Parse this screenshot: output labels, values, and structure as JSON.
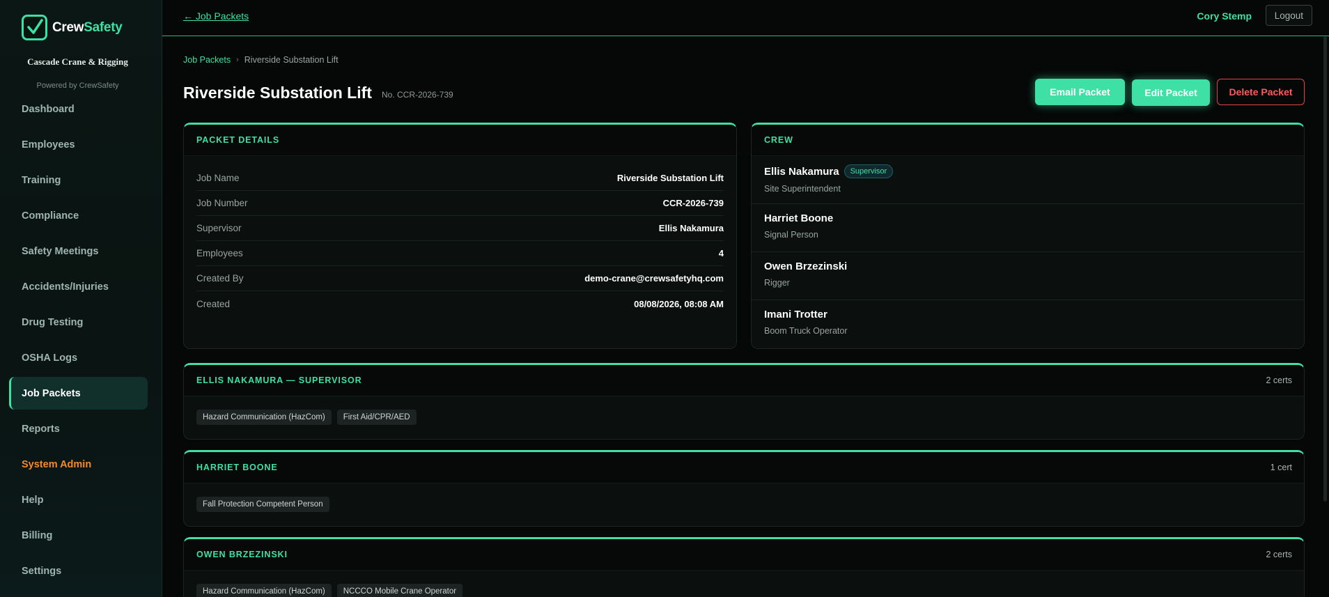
{
  "brand": {
    "word1": "Crew",
    "word2": "Safety"
  },
  "sidebar": {
    "company": "Cascade Crane & Rigging",
    "powered_by": "Powered by CrewSafety",
    "items": [
      {
        "label": "Dashboard"
      },
      {
        "label": "Employees"
      },
      {
        "label": "Training"
      },
      {
        "label": "Compliance"
      },
      {
        "label": "Safety Meetings"
      },
      {
        "label": "Accidents/Injuries"
      },
      {
        "label": "Drug Testing"
      },
      {
        "label": "OSHA Logs"
      },
      {
        "label": "Job Packets"
      },
      {
        "label": "Reports"
      },
      {
        "label": "System Admin"
      },
      {
        "label": "Help"
      },
      {
        "label": "Billing"
      },
      {
        "label": "Settings"
      }
    ]
  },
  "topbar": {
    "back_link": "← Job Packets",
    "user_name": "Cory Stemp",
    "logout": "Logout"
  },
  "breadcrumb": {
    "parent": "Job Packets",
    "separator": "›",
    "current": "Riverside Substation Lift"
  },
  "page": {
    "title": "Riverside Substation Lift",
    "job_number": "No. CCR-2026-739",
    "actions": {
      "email": "Email Packet",
      "edit": "Edit Packet",
      "delete": "Delete Packet"
    }
  },
  "packet_details": {
    "header": "PACKET DETAILS",
    "rows": [
      {
        "label": "Job Name",
        "value": "Riverside Substation Lift"
      },
      {
        "label": "Job Number",
        "value": "CCR-2026-739"
      },
      {
        "label": "Supervisor",
        "value": "Ellis Nakamura"
      },
      {
        "label": "Employees",
        "value": "4"
      },
      {
        "label": "Created By",
        "value": "demo-crane@crewsafetyhq.com"
      },
      {
        "label": "Created",
        "value": "08/08/2026, 08:08 AM"
      }
    ]
  },
  "crew": {
    "header": "CREW",
    "members": [
      {
        "name": "Ellis Nakamura",
        "badge": "Supervisor",
        "role": "Site Superintendent"
      },
      {
        "name": "Harriet Boone",
        "role": "Signal Person"
      },
      {
        "name": "Owen Brzezinski",
        "role": "Rigger"
      },
      {
        "name": "Imani Trotter",
        "role": "Boom Truck Operator"
      }
    ]
  },
  "cert_sections": [
    {
      "title": "ELLIS NAKAMURA — SUPERVISOR",
      "count": "2 certs",
      "certs": [
        "Hazard Communication (HazCom)",
        "First Aid/CPR/AED"
      ]
    },
    {
      "title": "HARRIET BOONE",
      "count": "1 cert",
      "certs": [
        "Fall Protection Competent Person"
      ]
    },
    {
      "title": "OWEN BRZEZINSKI",
      "count": "2 certs",
      "certs": [
        "Hazard Communication (HazCom)",
        "NCCCO Mobile Crane Operator"
      ]
    }
  ],
  "colors": {
    "accent": "#3ee0a5",
    "danger": "#ff5a5a",
    "admin": "#f58a2a",
    "background": "#050807"
  },
  "icons": {
    "logo": "checkmark-icon"
  }
}
